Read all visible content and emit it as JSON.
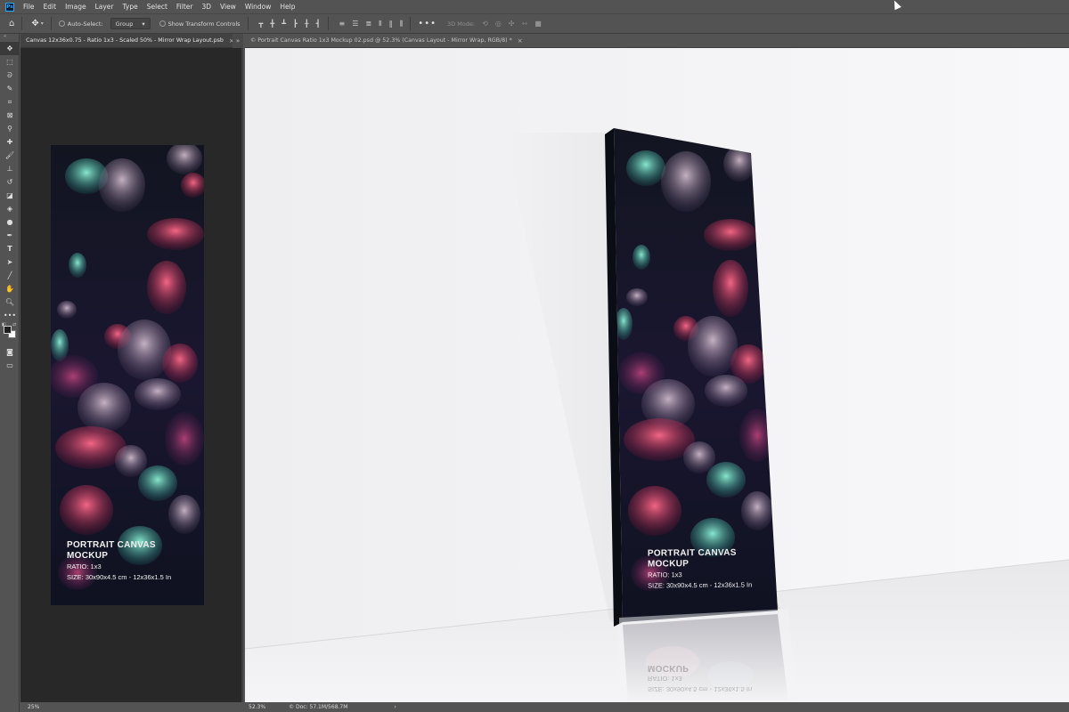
{
  "menu": {
    "items": [
      "File",
      "Edit",
      "Image",
      "Layer",
      "Type",
      "Select",
      "Filter",
      "3D",
      "View",
      "Window",
      "Help"
    ]
  },
  "options": {
    "auto_select_label": "Auto-Select:",
    "auto_select_value": "Group",
    "transform_label": "Show Transform Controls",
    "mode3d_label": "3D Mode:"
  },
  "documents": {
    "left": {
      "tab_title": "Canvas 12x36x0.75 - Ratio 1x3 - Scaled 50% - Mirror Wrap Layout.psb",
      "zoom": "25%"
    },
    "right": {
      "tab_title": "© Portrait Canvas Ratio 1x3 Mockup 02.psd @ 52.3% (Canvas Layout - Mirror Wrap, RGB/8) *",
      "zoom": "52.3%",
      "doc_info": "Doc: 57.1M/568.7M"
    }
  },
  "artwork": {
    "title_line1": "PORTRAIT CANVAS",
    "title_line2": "MOCKUP",
    "ratio_text": "RATIO:  1x3",
    "size_text": "SIZE: 30x90x4.5 cm - 12x36x1.5 In"
  },
  "colors": {
    "foreground": "#1f1f1f",
    "background": "#ffffff",
    "ps_accent": "#31a8ff"
  }
}
